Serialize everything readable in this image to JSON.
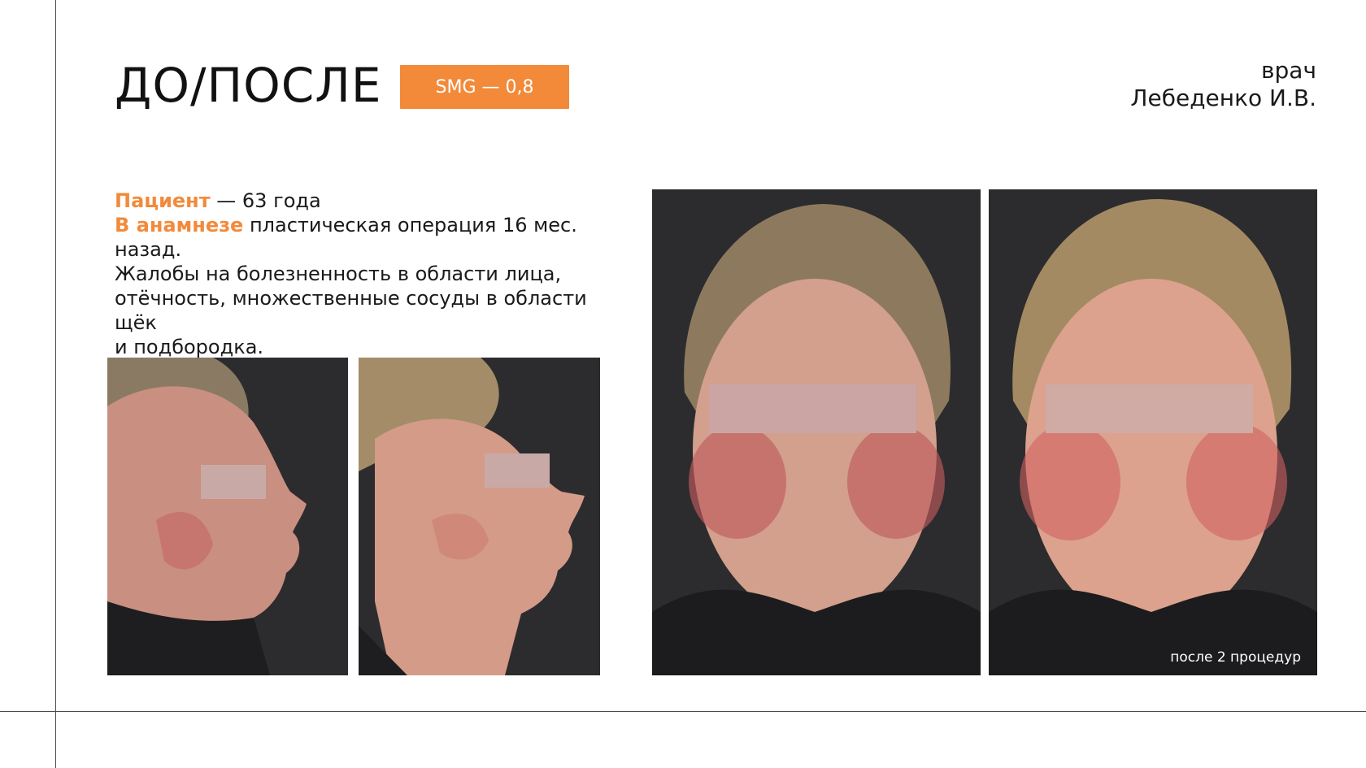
{
  "title": "ДО/ПОСЛЕ",
  "badge": "SMG — 0,8",
  "doctor": {
    "role": "врач",
    "name": "Лебеденко И.В."
  },
  "patient": {
    "label": "Пациент",
    "age": " — 63 года",
    "history_label": "В анамнезе",
    "history_line1": " пластическая операция 16 мес. назад.",
    "history_line2": "Жалобы на болезненность в области лица,",
    "history_line3": "отёчность, множественные сосуды в области щёк",
    "history_line4": "и подбородка."
  },
  "photos": {
    "after_caption": "после 2 процедур"
  },
  "colors": {
    "accent": "#f28a3a",
    "photo_bg": "#2c2c2e"
  }
}
